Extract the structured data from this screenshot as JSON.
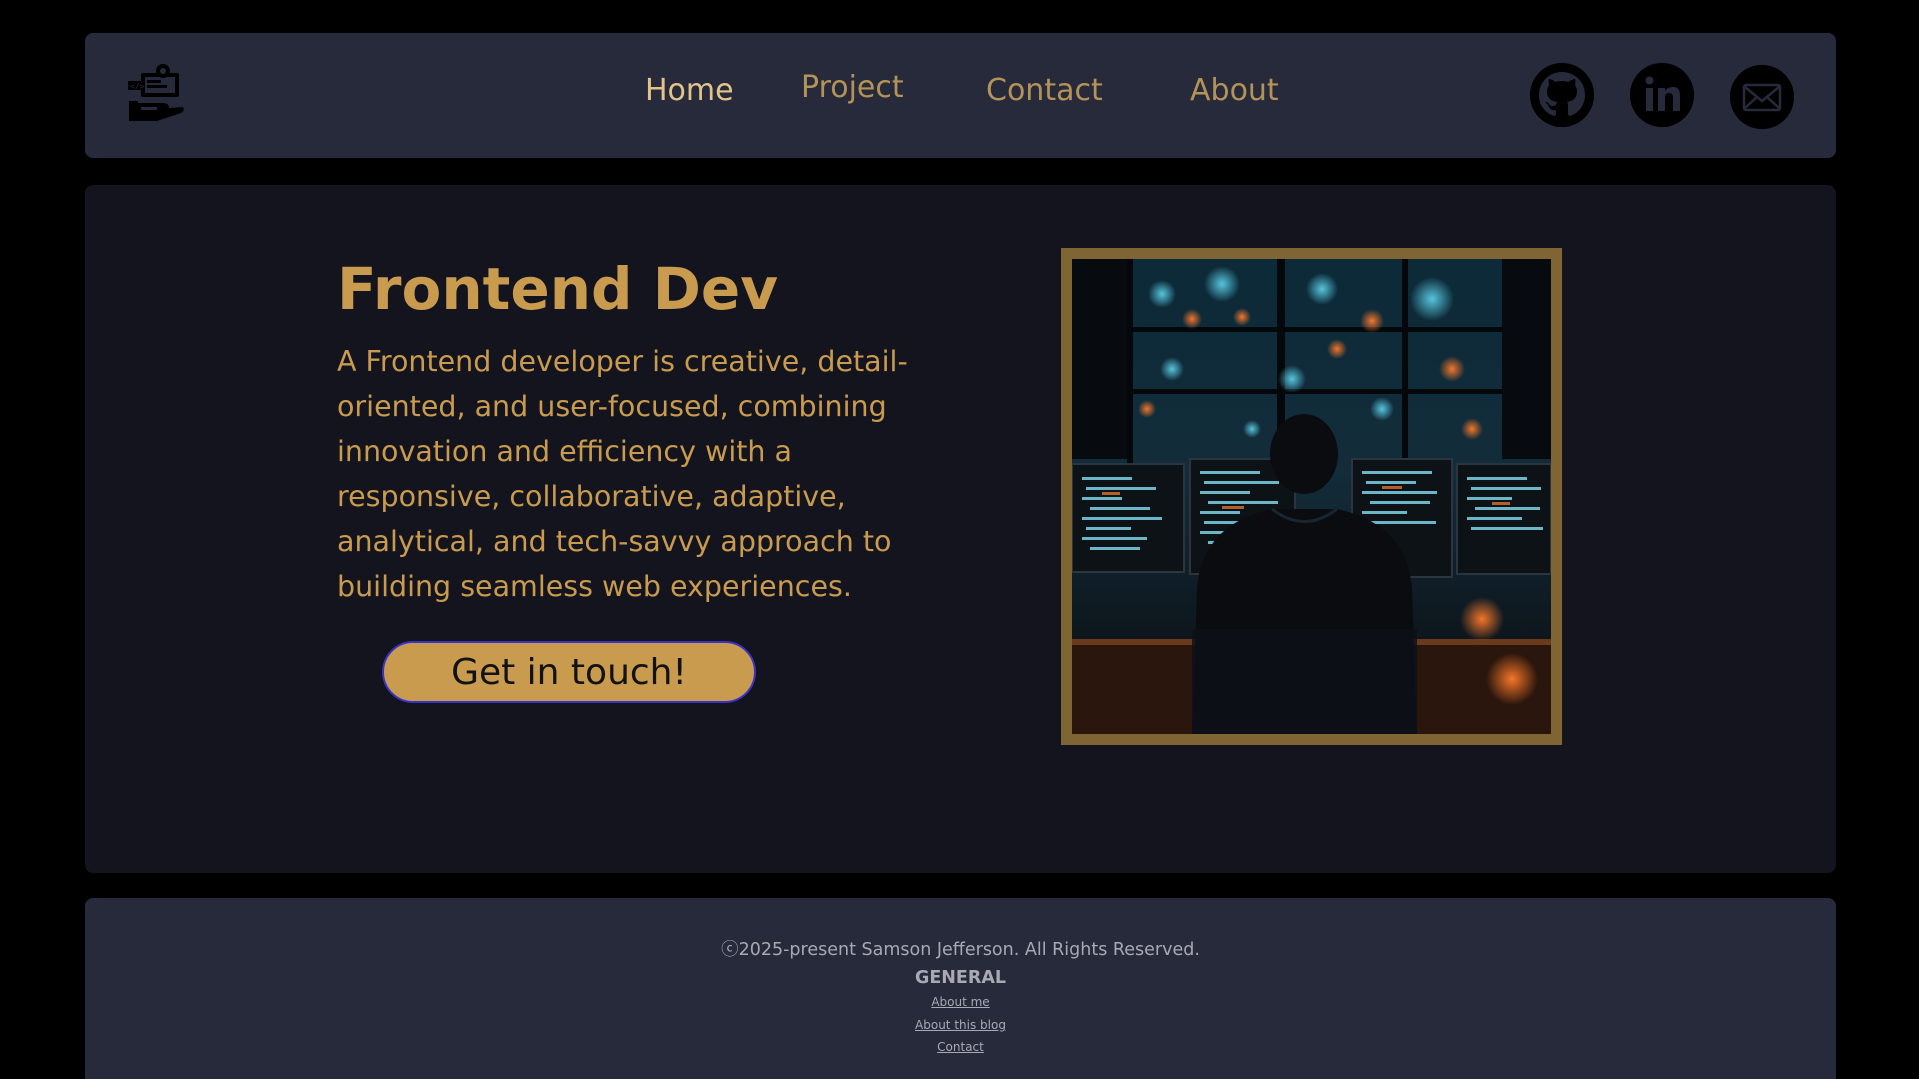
{
  "colors": {
    "page_background": "#000000",
    "panel_background": "#272a3b",
    "hero_background": "#14141e",
    "accent_gold": "#c99b4e",
    "nav_text": "#b39358",
    "nav_active_text": "#e2c48a",
    "frame_border": "#7f6533",
    "footer_text": "#a9a9b4"
  },
  "header": {
    "logo": "developer-workstation-logo-icon",
    "nav": {
      "home": "Home",
      "project": "Project",
      "contact": "Contact",
      "about": "About"
    },
    "active_nav": "Home",
    "social": [
      "github-icon",
      "linkedin-icon",
      "email-icon"
    ]
  },
  "hero": {
    "title": "Frontend Dev",
    "description": "A Frontend developer is creative, detail-oriented, and user-focused, combining innovation and efficiency with a responsive, collaborative, adaptive, analytical, and tech-savvy approach to building seamless web experiences.",
    "cta_label": "Get in touch!",
    "image": "developer-at-multi-monitor-desk-photo"
  },
  "footer": {
    "copyright": "ⓒ2025-present Samson Jefferson. All Rights Reserved.",
    "heading": "GENERAL",
    "links": {
      "about_me": "About me",
      "about_blog": "About this blog",
      "contact": "Contact"
    }
  }
}
